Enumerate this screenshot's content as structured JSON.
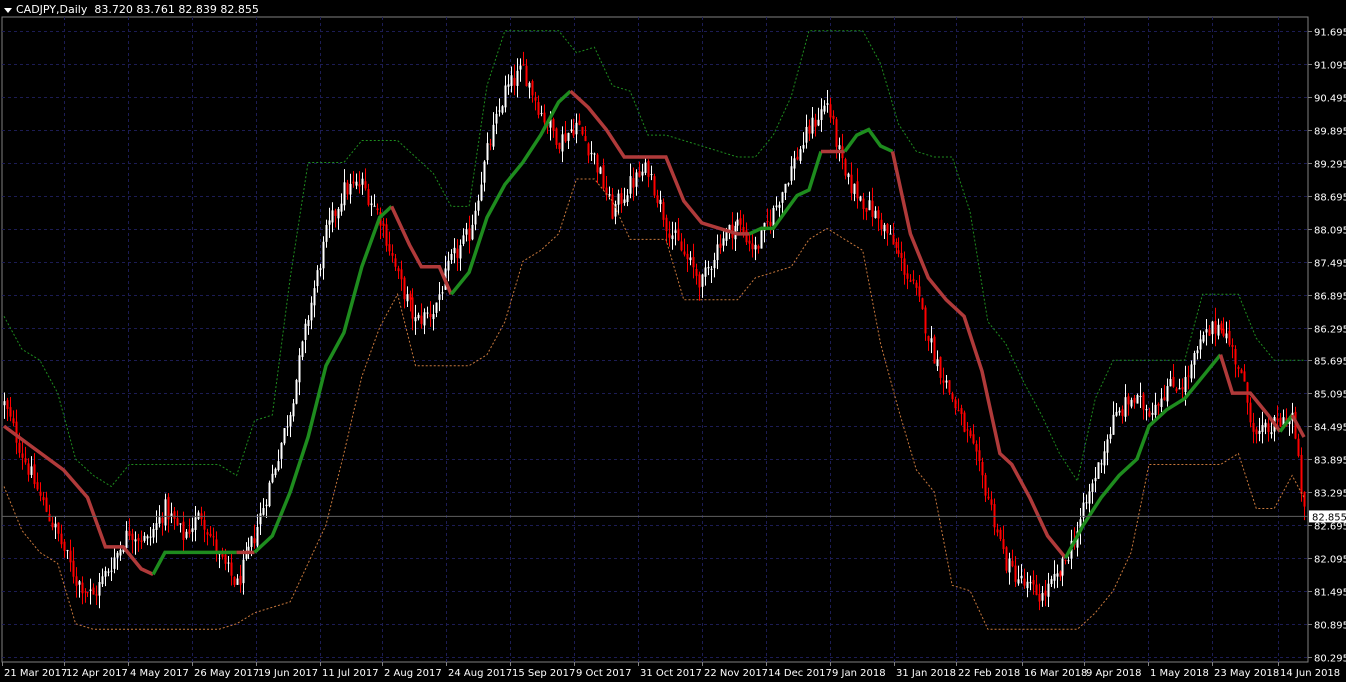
{
  "header": {
    "symbol": "CADJPY,Daily",
    "ohlc": "83.720 83.761 82.839 82.855"
  },
  "colors": {
    "background": "#000000",
    "grid": "#1c1c54",
    "bull_candle": "#ffffff",
    "bear_candle": "#ff0000",
    "upper_band": "#1e8c1e",
    "lower_band": "#c8783c",
    "trend_up_line": "#1e8c1e",
    "trend_down_line": "#b03a3a",
    "price_marker_bg": "#ffffff",
    "price_marker_text": "#000000"
  },
  "chart_data": {
    "type": "candlestick",
    "symbol": "CADJPY",
    "timeframe": "Daily",
    "y_ticks": [
      "91.695",
      "91.095",
      "90.495",
      "89.895",
      "89.295",
      "88.695",
      "88.095",
      "87.495",
      "86.895",
      "86.295",
      "85.695",
      "85.095",
      "84.495",
      "83.895",
      "83.295",
      "82.695",
      "82.095",
      "81.495",
      "80.895",
      "80.295"
    ],
    "ylim": [
      80.295,
      91.695
    ],
    "x_ticks": [
      "21 Mar 2017",
      "12 Apr 2017",
      "4 May 2017",
      "26 May 2017",
      "19 Jun 2017",
      "11 Jul 2017",
      "2 Aug 2017",
      "24 Aug 2017",
      "15 Sep 2017",
      "9 Oct 2017",
      "31 Oct 2017",
      "22 Nov 2017",
      "14 Dec 2017",
      "9 Jan 2018",
      "31 Jan 2018",
      "22 Feb 2018",
      "16 Mar 2018",
      "9 Apr 2018",
      "1 May 2018",
      "23 May 2018",
      "14 Jun 2018"
    ],
    "current_price": "82.855",
    "close_path": [
      [
        0,
        84.9
      ],
      [
        6,
        84.0
      ],
      [
        12,
        83.2
      ],
      [
        18,
        82.5
      ],
      [
        24,
        81.7
      ],
      [
        30,
        81.4
      ],
      [
        36,
        82.0
      ],
      [
        42,
        82.6
      ],
      [
        48,
        82.4
      ],
      [
        54,
        83.0
      ],
      [
        60,
        82.5
      ],
      [
        66,
        82.9
      ],
      [
        72,
        82.1
      ],
      [
        78,
        81.6
      ],
      [
        84,
        82.5
      ],
      [
        90,
        83.6
      ],
      [
        96,
        84.8
      ],
      [
        102,
        86.5
      ],
      [
        108,
        88.0
      ],
      [
        114,
        88.8
      ],
      [
        120,
        88.9
      ],
      [
        126,
        88.3
      ],
      [
        132,
        87.2
      ],
      [
        138,
        86.4
      ],
      [
        144,
        86.6
      ],
      [
        150,
        87.5
      ],
      [
        156,
        88.0
      ],
      [
        162,
        89.5
      ],
      [
        168,
        90.6
      ],
      [
        174,
        91.0
      ],
      [
        180,
        90.2
      ],
      [
        186,
        89.7
      ],
      [
        192,
        90.0
      ],
      [
        198,
        89.4
      ],
      [
        204,
        88.4
      ],
      [
        210,
        88.9
      ],
      [
        216,
        89.2
      ],
      [
        222,
        88.2
      ],
      [
        228,
        87.6
      ],
      [
        234,
        87.1
      ],
      [
        240,
        87.9
      ],
      [
        246,
        88.2
      ],
      [
        252,
        87.7
      ],
      [
        258,
        88.4
      ],
      [
        264,
        89.2
      ],
      [
        270,
        89.9
      ],
      [
        276,
        90.4
      ],
      [
        282,
        89.0
      ],
      [
        288,
        88.6
      ],
      [
        294,
        88.2
      ],
      [
        300,
        87.6
      ],
      [
        306,
        86.9
      ],
      [
        312,
        85.8
      ],
      [
        318,
        85.0
      ],
      [
        324,
        84.2
      ],
      [
        330,
        83.2
      ],
      [
        336,
        82.0
      ],
      [
        342,
        81.6
      ],
      [
        348,
        81.4
      ],
      [
        354,
        81.8
      ],
      [
        360,
        82.6
      ],
      [
        366,
        83.6
      ],
      [
        372,
        84.6
      ],
      [
        378,
        85.0
      ],
      [
        384,
        84.8
      ],
      [
        390,
        85.2
      ],
      [
        396,
        85.3
      ],
      [
        402,
        86.1
      ],
      [
        408,
        86.4
      ],
      [
        414,
        85.6
      ],
      [
        420,
        84.3
      ],
      [
        426,
        84.5
      ],
      [
        432,
        84.7
      ],
      [
        436,
        82.9
      ]
    ],
    "upper_band_path": [
      [
        0,
        86.5
      ],
      [
        6,
        85.9
      ],
      [
        12,
        85.7
      ],
      [
        18,
        85.1
      ],
      [
        24,
        83.9
      ],
      [
        30,
        83.6
      ],
      [
        36,
        83.4
      ],
      [
        42,
        83.8
      ],
      [
        48,
        83.8
      ],
      [
        54,
        83.8
      ],
      [
        60,
        83.8
      ],
      [
        66,
        83.8
      ],
      [
        72,
        83.8
      ],
      [
        78,
        83.6
      ],
      [
        84,
        84.6
      ],
      [
        90,
        84.7
      ],
      [
        96,
        87.2
      ],
      [
        102,
        89.3
      ],
      [
        108,
        89.3
      ],
      [
        114,
        89.3
      ],
      [
        120,
        89.7
      ],
      [
        126,
        89.7
      ],
      [
        132,
        89.7
      ],
      [
        138,
        89.4
      ],
      [
        144,
        89.1
      ],
      [
        150,
        88.5
      ],
      [
        156,
        88.5
      ],
      [
        162,
        90.7
      ],
      [
        168,
        91.7
      ],
      [
        174,
        91.7
      ],
      [
        180,
        91.7
      ],
      [
        186,
        91.7
      ],
      [
        192,
        91.3
      ],
      [
        198,
        91.4
      ],
      [
        204,
        90.7
      ],
      [
        210,
        90.6
      ],
      [
        216,
        89.8
      ],
      [
        222,
        89.8
      ],
      [
        228,
        89.7
      ],
      [
        234,
        89.6
      ],
      [
        240,
        89.5
      ],
      [
        246,
        89.4
      ],
      [
        252,
        89.4
      ],
      [
        258,
        89.8
      ],
      [
        264,
        90.5
      ],
      [
        270,
        91.7
      ],
      [
        276,
        91.7
      ],
      [
        282,
        91.7
      ],
      [
        288,
        91.7
      ],
      [
        294,
        91.1
      ],
      [
        300,
        90.0
      ],
      [
        306,
        89.5
      ],
      [
        312,
        89.4
      ],
      [
        318,
        89.4
      ],
      [
        324,
        88.4
      ],
      [
        330,
        86.4
      ],
      [
        336,
        86.0
      ],
      [
        342,
        85.3
      ],
      [
        348,
        84.7
      ],
      [
        354,
        84.0
      ],
      [
        360,
        83.5
      ],
      [
        366,
        85.0
      ],
      [
        372,
        85.7
      ],
      [
        378,
        85.7
      ],
      [
        384,
        85.7
      ],
      [
        390,
        85.7
      ],
      [
        396,
        85.7
      ],
      [
        402,
        86.9
      ],
      [
        408,
        86.9
      ],
      [
        414,
        86.9
      ],
      [
        420,
        86.1
      ],
      [
        426,
        85.7
      ],
      [
        432,
        85.7
      ],
      [
        436,
        85.7
      ]
    ],
    "lower_band_path": [
      [
        0,
        83.4
      ],
      [
        6,
        82.6
      ],
      [
        12,
        82.2
      ],
      [
        18,
        82.0
      ],
      [
        24,
        80.9
      ],
      [
        30,
        80.8
      ],
      [
        36,
        80.8
      ],
      [
        42,
        80.8
      ],
      [
        48,
        80.8
      ],
      [
        54,
        80.8
      ],
      [
        60,
        80.8
      ],
      [
        66,
        80.8
      ],
      [
        72,
        80.8
      ],
      [
        78,
        80.9
      ],
      [
        84,
        81.1
      ],
      [
        90,
        81.2
      ],
      [
        96,
        81.3
      ],
      [
        102,
        82.0
      ],
      [
        108,
        82.7
      ],
      [
        114,
        84.0
      ],
      [
        120,
        85.4
      ],
      [
        126,
        86.3
      ],
      [
        132,
        86.9
      ],
      [
        138,
        85.6
      ],
      [
        144,
        85.6
      ],
      [
        150,
        85.6
      ],
      [
        156,
        85.6
      ],
      [
        162,
        85.8
      ],
      [
        168,
        86.4
      ],
      [
        174,
        87.5
      ],
      [
        180,
        87.7
      ],
      [
        186,
        88.0
      ],
      [
        192,
        89.0
      ],
      [
        198,
        89.0
      ],
      [
        204,
        88.6
      ],
      [
        210,
        87.9
      ],
      [
        216,
        87.9
      ],
      [
        222,
        87.9
      ],
      [
        228,
        86.8
      ],
      [
        234,
        86.8
      ],
      [
        240,
        86.8
      ],
      [
        246,
        86.8
      ],
      [
        252,
        87.2
      ],
      [
        258,
        87.3
      ],
      [
        264,
        87.4
      ],
      [
        270,
        87.9
      ],
      [
        276,
        88.1
      ],
      [
        282,
        87.9
      ],
      [
        288,
        87.7
      ],
      [
        294,
        86.0
      ],
      [
        300,
        84.8
      ],
      [
        306,
        83.7
      ],
      [
        312,
        83.3
      ],
      [
        318,
        81.6
      ],
      [
        324,
        81.5
      ],
      [
        330,
        80.8
      ],
      [
        336,
        80.8
      ],
      [
        342,
        80.8
      ],
      [
        348,
        80.8
      ],
      [
        354,
        80.8
      ],
      [
        360,
        80.8
      ],
      [
        366,
        81.1
      ],
      [
        372,
        81.5
      ],
      [
        378,
        82.2
      ],
      [
        384,
        83.8
      ],
      [
        390,
        83.8
      ],
      [
        396,
        83.8
      ],
      [
        402,
        83.8
      ],
      [
        408,
        83.8
      ],
      [
        414,
        84.0
      ],
      [
        420,
        83.0
      ],
      [
        426,
        83.0
      ],
      [
        432,
        83.6
      ],
      [
        436,
        83.2
      ]
    ],
    "trend_line_segments": [
      {
        "dir": "down",
        "points": [
          [
            0,
            84.5
          ],
          [
            10,
            84.1
          ],
          [
            20,
            83.7
          ],
          [
            28,
            83.2
          ],
          [
            34,
            82.3
          ],
          [
            40,
            82.3
          ],
          [
            46,
            81.9
          ],
          [
            50,
            81.8
          ]
        ]
      },
      {
        "dir": "up",
        "points": [
          [
            50,
            81.8
          ],
          [
            54,
            82.2
          ],
          [
            60,
            82.2
          ],
          [
            70,
            82.2
          ],
          [
            78,
            82.2
          ]
        ]
      },
      {
        "dir": "down",
        "points": [
          [
            78,
            82.2
          ],
          [
            84,
            82.2
          ]
        ]
      },
      {
        "dir": "up",
        "points": [
          [
            84,
            82.2
          ],
          [
            90,
            82.5
          ],
          [
            96,
            83.3
          ],
          [
            102,
            84.3
          ],
          [
            108,
            85.6
          ],
          [
            114,
            86.2
          ],
          [
            120,
            87.4
          ],
          [
            126,
            88.3
          ],
          [
            130,
            88.5
          ]
        ]
      },
      {
        "dir": "down",
        "points": [
          [
            130,
            88.5
          ],
          [
            136,
            87.8
          ],
          [
            140,
            87.4
          ],
          [
            146,
            87.4
          ],
          [
            150,
            86.9
          ]
        ]
      },
      {
        "dir": "up",
        "points": [
          [
            150,
            86.9
          ],
          [
            156,
            87.3
          ],
          [
            162,
            88.3
          ],
          [
            168,
            88.9
          ],
          [
            174,
            89.3
          ],
          [
            180,
            89.8
          ],
          [
            186,
            90.4
          ],
          [
            190,
            90.6
          ]
        ]
      },
      {
        "dir": "down",
        "points": [
          [
            190,
            90.6
          ],
          [
            196,
            90.3
          ],
          [
            202,
            89.9
          ],
          [
            208,
            89.4
          ],
          [
            216,
            89.4
          ],
          [
            222,
            89.4
          ],
          [
            228,
            88.6
          ],
          [
            234,
            88.2
          ],
          [
            240,
            88.1
          ],
          [
            246,
            88.0
          ],
          [
            250,
            88.0
          ]
        ]
      },
      {
        "dir": "up",
        "points": [
          [
            250,
            88.0
          ],
          [
            254,
            88.1
          ],
          [
            258,
            88.1
          ],
          [
            262,
            88.4
          ],
          [
            266,
            88.7
          ],
          [
            270,
            88.8
          ],
          [
            274,
            89.5
          ]
        ]
      },
      {
        "dir": "down",
        "points": [
          [
            274,
            89.5
          ],
          [
            278,
            89.5
          ],
          [
            282,
            89.5
          ]
        ]
      },
      {
        "dir": "up",
        "points": [
          [
            282,
            89.5
          ],
          [
            286,
            89.8
          ],
          [
            290,
            89.9
          ],
          [
            294,
            89.6
          ],
          [
            298,
            89.5
          ]
        ]
      },
      {
        "dir": "down",
        "points": [
          [
            298,
            89.5
          ],
          [
            304,
            88.0
          ],
          [
            310,
            87.2
          ],
          [
            316,
            86.8
          ],
          [
            322,
            86.5
          ],
          [
            328,
            85.5
          ],
          [
            334,
            84.0
          ],
          [
            338,
            83.8
          ],
          [
            344,
            83.2
          ],
          [
            350,
            82.5
          ],
          [
            356,
            82.1
          ]
        ]
      },
      {
        "dir": "up",
        "points": [
          [
            356,
            82.1
          ],
          [
            362,
            82.7
          ],
          [
            368,
            83.2
          ],
          [
            374,
            83.6
          ],
          [
            380,
            83.9
          ],
          [
            384,
            84.5
          ],
          [
            390,
            84.8
          ],
          [
            396,
            85.0
          ],
          [
            402,
            85.4
          ],
          [
            408,
            85.8
          ]
        ]
      },
      {
        "dir": "down",
        "points": [
          [
            408,
            85.8
          ],
          [
            412,
            85.1
          ],
          [
            418,
            85.1
          ],
          [
            424,
            84.7
          ],
          [
            428,
            84.4
          ]
        ]
      },
      {
        "dir": "up",
        "points": [
          [
            428,
            84.4
          ],
          [
            432,
            84.7
          ]
        ]
      },
      {
        "dir": "down",
        "points": [
          [
            432,
            84.7
          ],
          [
            436,
            84.3
          ]
        ]
      }
    ]
  }
}
